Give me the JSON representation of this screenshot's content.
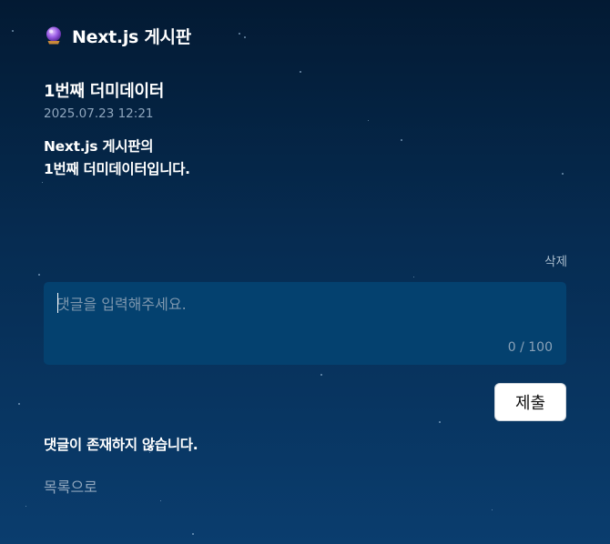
{
  "header": {
    "title": "Next.js 게시판",
    "logo_icon": "crystal-ball-icon"
  },
  "post": {
    "title": "1번째 더미데이터",
    "date": "2025.07.23 12:21",
    "body_lines": [
      "Next.js 게시판의",
      "1번째 더미데이터입니다."
    ],
    "delete_label": "삭제"
  },
  "comment_form": {
    "placeholder": "댓글을 입력해주세요.",
    "value": "",
    "counter": "0 / 100",
    "submit_label": "제출"
  },
  "comments": {
    "empty_message": "댓글이 존재하지 않습니다."
  },
  "footer": {
    "back_label": "목록으로"
  },
  "colors": {
    "background_top": "#031a33",
    "background_bottom": "#0a3d6e",
    "input_background": "#04416f",
    "muted_text": "#8fa6bd"
  }
}
